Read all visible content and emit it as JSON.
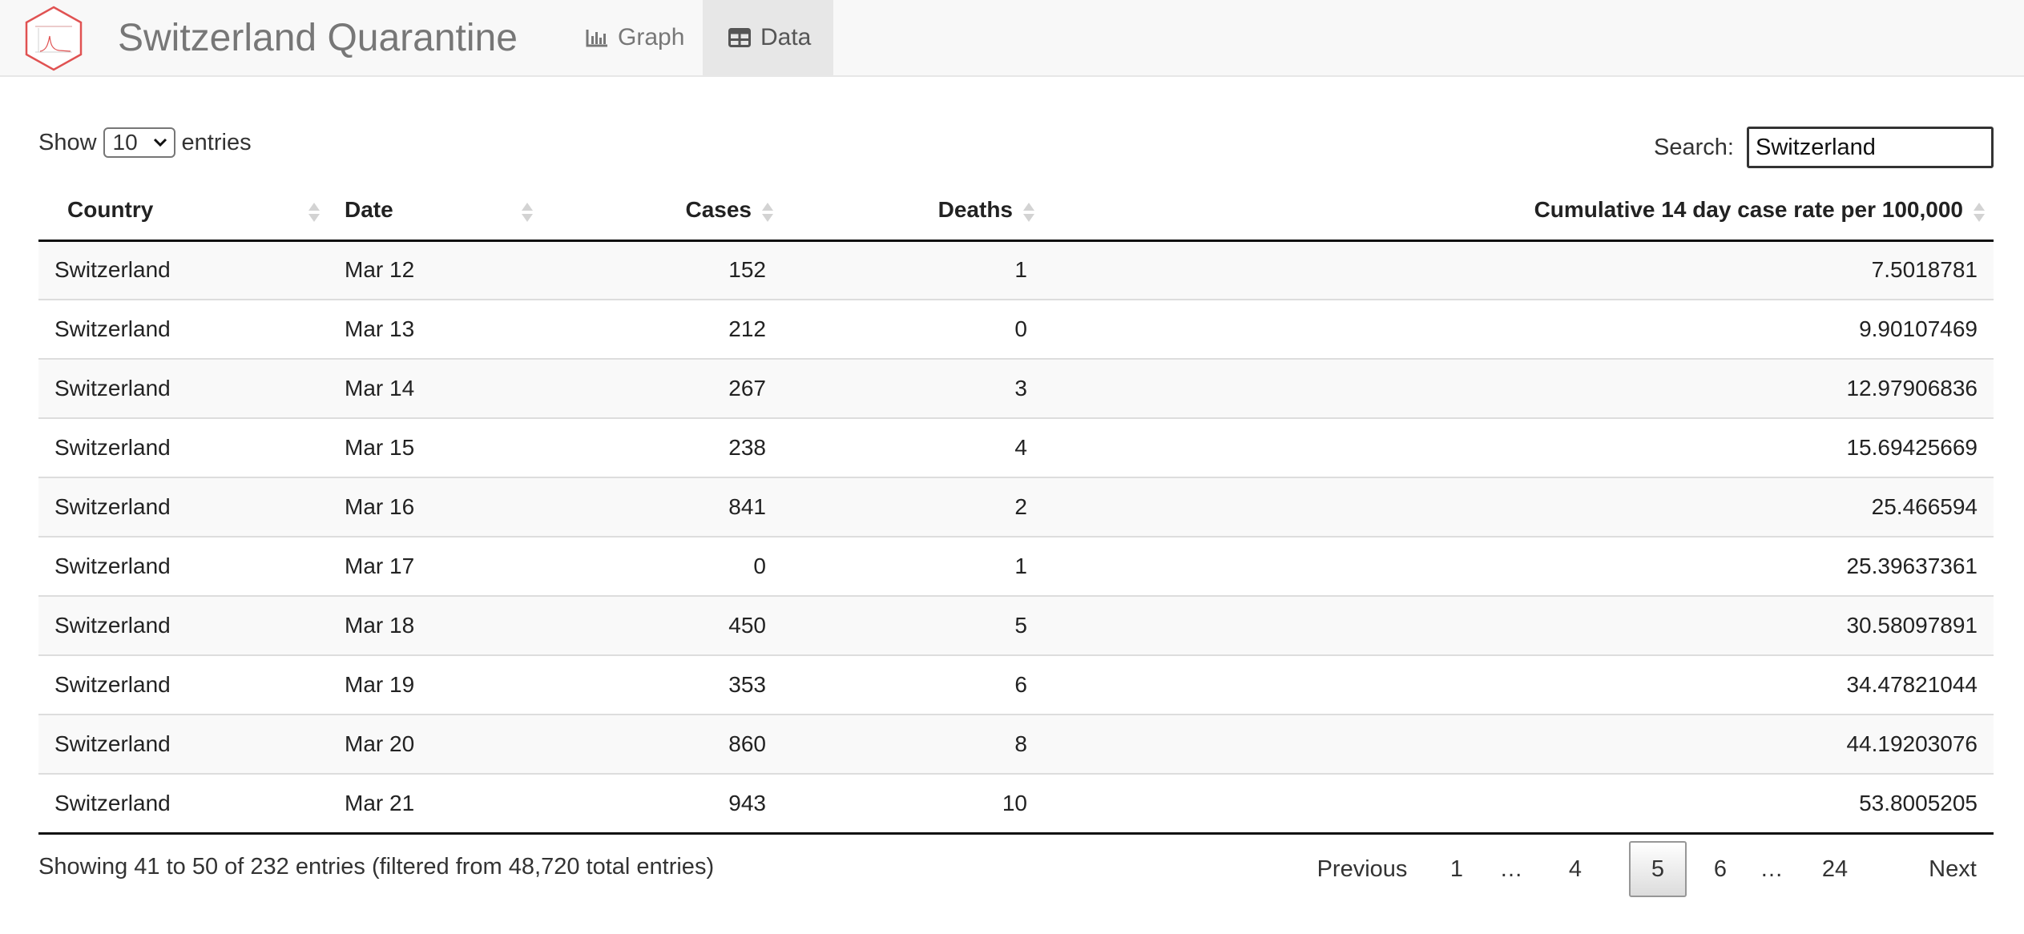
{
  "app": {
    "title": "Switzerland Quarantine"
  },
  "nav": {
    "tabs": [
      {
        "label": "Graph",
        "icon": "bar-chart-icon",
        "active": false
      },
      {
        "label": "Data",
        "icon": "table-icon",
        "active": true
      }
    ]
  },
  "length": {
    "prefix": "Show",
    "value": "10",
    "suffix": "entries"
  },
  "search": {
    "label": "Search:",
    "value": "Switzerland"
  },
  "table": {
    "columns": [
      "Country",
      "Date",
      "Cases",
      "Deaths",
      "Cumulative 14 day case rate per 100,000"
    ],
    "rows": [
      [
        "Switzerland",
        "Mar 12",
        "152",
        "1",
        "7.5018781"
      ],
      [
        "Switzerland",
        "Mar 13",
        "212",
        "0",
        "9.90107469"
      ],
      [
        "Switzerland",
        "Mar 14",
        "267",
        "3",
        "12.97906836"
      ],
      [
        "Switzerland",
        "Mar 15",
        "238",
        "4",
        "15.69425669"
      ],
      [
        "Switzerland",
        "Mar 16",
        "841",
        "2",
        "25.466594"
      ],
      [
        "Switzerland",
        "Mar 17",
        "0",
        "1",
        "25.39637361"
      ],
      [
        "Switzerland",
        "Mar 18",
        "450",
        "5",
        "30.58097891"
      ],
      [
        "Switzerland",
        "Mar 19",
        "353",
        "6",
        "34.47821044"
      ],
      [
        "Switzerland",
        "Mar 20",
        "860",
        "8",
        "44.19203076"
      ],
      [
        "Switzerland",
        "Mar 21",
        "943",
        "10",
        "53.8005205"
      ]
    ]
  },
  "info": "Showing 41 to 50 of 232 entries (filtered from 48,720 total entries)",
  "pagination": {
    "previous": "Previous",
    "pages": [
      "1",
      "…",
      "4",
      "5",
      "6",
      "…",
      "24"
    ],
    "current": "5",
    "next": "Next"
  },
  "colors": {
    "navbar_bg": "#f8f8f8",
    "active_tab_bg": "#e7e7e7",
    "logo_stroke": "#e05252",
    "brand_text": "#777777"
  }
}
